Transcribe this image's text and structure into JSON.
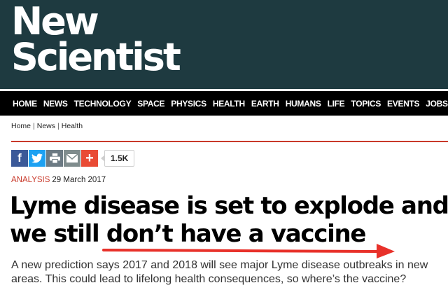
{
  "brand": {
    "logo_line1": "New",
    "logo_line2": "Scientist",
    "colors": {
      "masthead": "#1e3a40",
      "nav": "#000000",
      "accent": "#c9392a",
      "annotation_arrow": "#e8312a"
    }
  },
  "nav": {
    "items": [
      "HOME",
      "NEWS",
      "TECHNOLOGY",
      "SPACE",
      "PHYSICS",
      "HEALTH",
      "EARTH",
      "HUMANS",
      "LIFE",
      "TOPICS",
      "EVENTS",
      "JOBS"
    ]
  },
  "breadcrumb": {
    "items": [
      "Home",
      "News",
      "Health"
    ],
    "separator": "|"
  },
  "share": {
    "buttons": [
      {
        "icon": "facebook-icon",
        "glyph": "f",
        "color": "#3b5998"
      },
      {
        "icon": "twitter-icon",
        "glyph": "",
        "color": "#1da1f2"
      },
      {
        "icon": "print-icon",
        "glyph": "",
        "color": "#6c7a83"
      },
      {
        "icon": "email-icon",
        "glyph": "",
        "color": "#7f8c8d"
      },
      {
        "icon": "plus-icon",
        "glyph": "+",
        "color": "#e94b35"
      }
    ],
    "count": "1.5K"
  },
  "article": {
    "kicker": "ANALYSIS",
    "date": "29 March 2017",
    "headline_line1": "Lyme disease is set to explode and",
    "headline_line2": "we still don’t have a vaccine",
    "standfirst": "A new prediction says 2017 and 2018 will see major Lyme disease outbreaks in new areas. This could lead to lifelong health consequences, so where’s the vaccine?"
  }
}
